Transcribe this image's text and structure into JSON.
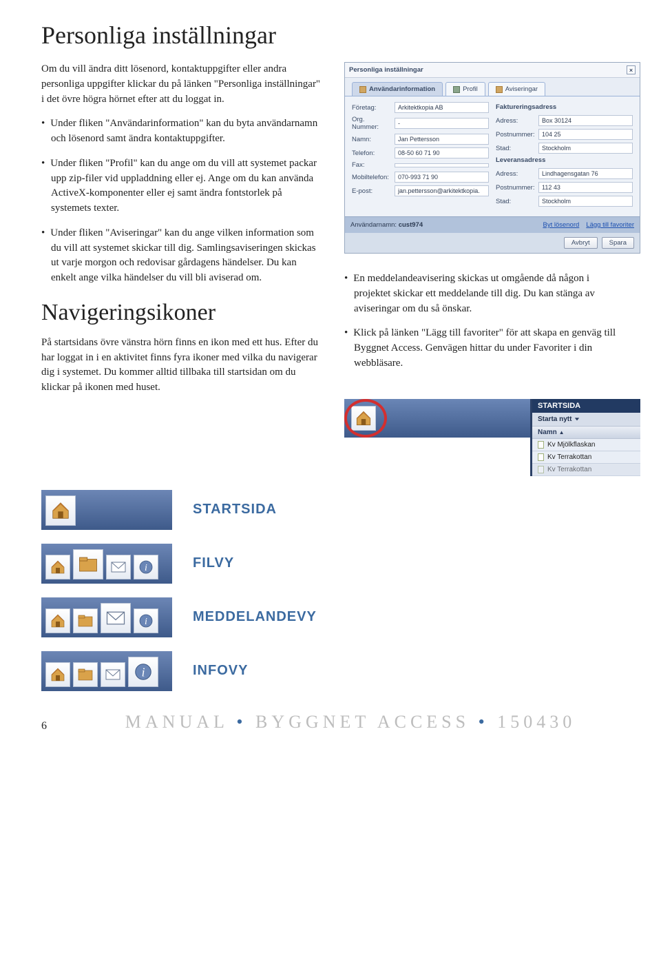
{
  "h1": "Personliga inställningar",
  "intro": "Om du vill ändra ditt lösenord, kontaktuppgifter eller andra personliga uppgifter klickar du på länken \"Personliga inställningar\" i det övre högra hörnet efter att du loggat in.",
  "list_left": [
    "Under fliken \"Användarinformation\" kan du byta användarnamn och lösenord samt ändra kontaktuppgifter.",
    "Under fliken \"Profil\" kan du ange om du vill att systemet packar upp zip-filer vid uppladdning eller ej. Ange om du kan använda ActiveX-komponenter eller ej samt ändra fontstorlek på systemets texter.",
    "Under fliken \"Aviseringar\" kan du ange vilken information som du vill att systemet skickar till dig. Samlingsaviseringen skickas ut varje morgon och redovisar gårdagens händelser. Du kan enkelt ange vilka händelser du vill bli aviserad om."
  ],
  "list_right": [
    "En meddelandeavisering skickas ut omgående då någon i projektet skickar ett meddelande till dig. Du kan stänga av aviseringar om du så önskar.",
    "Klick på länken \"Lägg till favoriter\" för att skapa en genväg till Byggnet Access. Genvägen hittar du under Favoriter i din webbläsare."
  ],
  "h2": "Navigeringsikoner",
  "nav_para": "På startsidans övre vänstra hörn finns en ikon med ett hus. Efter du har loggat in i en aktivitet finns fyra ikoner med vilka du navigerar dig i systemet. Du kommer alltid tillbaka till startsidan om du klickar på ikonen med huset.",
  "dialog": {
    "title": "Personliga inställningar",
    "tabs": [
      "Användarinformation",
      "Profil",
      "Aviseringar"
    ],
    "left_section": {
      "title": "",
      "fields": {
        "foretag_lbl": "Företag:",
        "foretag": "Arkitektkopia AB",
        "org_lbl": "Org. Nummer:",
        "org": "-",
        "namn_lbl": "Namn:",
        "namn": "Jan Pettersson",
        "tel_lbl": "Telefon:",
        "tel": "08-50 60 71 90",
        "fax_lbl": "Fax:",
        "fax": "",
        "mobil_lbl": "Mobiltelefon:",
        "mobil": "070-993 71 90",
        "epost_lbl": "E-post:",
        "epost": "jan.pettersson@arkitektkopia."
      }
    },
    "right_sections": {
      "fakt_title": "Faktureringsadress",
      "fakt": {
        "adress_lbl": "Adress:",
        "adress": "Box 30124",
        "post_lbl": "Postnummer:",
        "post": "104 25",
        "stad_lbl": "Stad:",
        "stad": "Stockholm"
      },
      "lev_title": "Leveransadress",
      "lev": {
        "adress_lbl": "Adress:",
        "adress": "Lindhagensgatan 76",
        "post_lbl": "Postnummer:",
        "post": "112 43",
        "stad_lbl": "Stad:",
        "stad": "Stockholm"
      }
    },
    "user_lbl": "Användarnamn:",
    "user": "cust974",
    "byt": "Byt lösenord",
    "fav": "Lägg till favoriter",
    "avbryt": "Avbryt",
    "spara": "Spara"
  },
  "startpage": {
    "right_hdr": "STARTSIDA",
    "starta": "Starta nytt",
    "colhdr": "Namn",
    "rows": [
      "Kv Mjölkflaskan",
      "Kv Terrakottan",
      "Kv Terrakottan"
    ]
  },
  "barlabels": {
    "start": "STARTSIDA",
    "filvy": "FILVY",
    "medd": "MEDDELANDEVY",
    "info": "INFOVY"
  },
  "footer": {
    "page": "6",
    "text_a": "MANUAL",
    "text_b": "BYGGNET ACCESS",
    "text_c": "150430"
  }
}
